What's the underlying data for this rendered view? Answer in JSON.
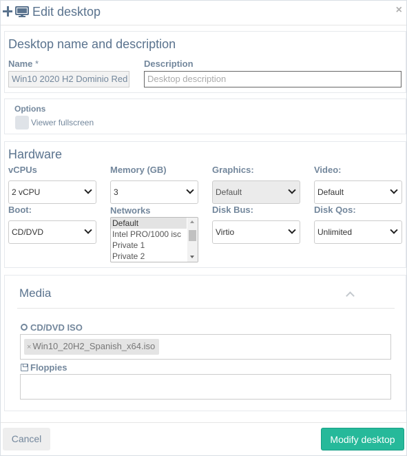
{
  "header": {
    "title": "Edit desktop",
    "close_label": "×"
  },
  "name_section": {
    "title": "Desktop name and description",
    "name_label": "Name",
    "name_required": "*",
    "name_value": "Win10 2020 H2 Dominio Red",
    "description_label": "Description",
    "description_placeholder": "Desktop description"
  },
  "options": {
    "title": "Options",
    "viewer_fullscreen_label": "Viewer fullscreen",
    "viewer_fullscreen_checked": false
  },
  "hardware": {
    "title": "Hardware",
    "vcpus_label": "vCPUs",
    "vcpus_value": "2 vCPU",
    "memory_label": "Memory (GB)",
    "memory_value": "3",
    "graphics_label": "Graphics:",
    "graphics_value": "Default",
    "video_label": "Video:",
    "video_value": "Default",
    "boot_label": "Boot:",
    "boot_value": "CD/DVD",
    "networks_label": "Networks",
    "networks_options": [
      "Default",
      "Intel PRO/1000 isc",
      "Private 1",
      "Private 2"
    ],
    "networks_selected": "Default",
    "disk_bus_label": "Disk Bus:",
    "disk_bus_value": "Virtio",
    "disk_qos_label": "Disk Qos:",
    "disk_qos_value": "Unlimited"
  },
  "media": {
    "title": "Media",
    "cd_label": "CD/DVD ISO",
    "cd_tag": "Win10_20H2_Spanish_x64.iso",
    "tag_remove": "×",
    "floppies_label": "Floppies"
  },
  "footer": {
    "cancel_label": "Cancel",
    "submit_label": "Modify desktop"
  },
  "colors": {
    "primary": "#26b99a",
    "title_text": "#5a738e",
    "label_text": "#73879c"
  }
}
